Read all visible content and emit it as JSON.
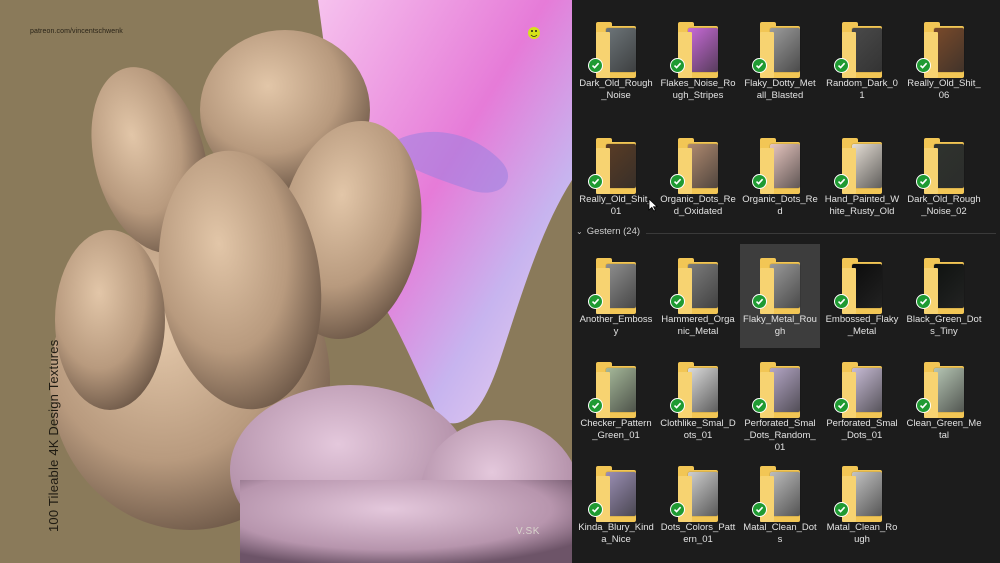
{
  "artwork": {
    "patreon_text": "patreon.com/vincentschwenk",
    "vertical_title": "100 Tileable 4K Design Textures",
    "signature": "V.SK",
    "colors": {
      "background": "#8a7a5a",
      "blob": "#b69a82",
      "rock": "#c9a9c4",
      "pink": "#f0a8e4"
    }
  },
  "explorer": {
    "group_label": "Gestern (24)",
    "check_color": "#1f9a32",
    "folder_color": "#f2c655",
    "top_grid": [
      {
        "label": "Dark_Old_Rough_Noise",
        "thumb": "#6d7579"
      },
      {
        "label": "Flakes_Noise_Rough_Stripes",
        "thumb": "#c86ad8"
      },
      {
        "label": "Flaky_Dotty_Metall_Blasted",
        "thumb": "#9c9c9c"
      },
      {
        "label": "Random_Dark_01",
        "thumb": "#4a4a4a"
      },
      {
        "label": "Really_Old_Shit_06",
        "thumb": "#7a4a2a"
      },
      {
        "label": "Really_Old_Shit_01",
        "thumb": "#5a3c25"
      },
      {
        "label": "Organic_Dots_Red_Oxidated",
        "thumb": "#b08a70"
      },
      {
        "label": "Organic_Dots_Red",
        "thumb": "#e8c6c0"
      },
      {
        "label": "Hand_Painted_White_Rusty_Old",
        "thumb": "#e6dfd6"
      },
      {
        "label": "Dark_Old_Rough_Noise_02",
        "thumb": "#2f332e"
      }
    ],
    "bottom_grid": [
      {
        "label": "Another_Embossy",
        "thumb": "#8f8f8f"
      },
      {
        "label": "Hammered_Organic_Metal",
        "thumb": "#7c7c7c"
      },
      {
        "label": "Flaky_Metal_Rough",
        "thumb": "#9a9a9a",
        "selected": true
      },
      {
        "label": "Embossed_Flaky_Metal",
        "thumb": "#0c0c0c"
      },
      {
        "label": "Black_Green_Dots_Tiny",
        "thumb": "#0f1210"
      },
      {
        "label": "Checker_Pattern_Green_01",
        "thumb": "#a6b99a"
      },
      {
        "label": "Clothlike_Smal_Dots_01",
        "thumb": "#dcdcdc"
      },
      {
        "label": "Perforated_Smal_Dots_Random_01",
        "thumb": "#b4a6c6"
      },
      {
        "label": "Perforated_Smal_Dots_01",
        "thumb": "#c8bcd6"
      },
      {
        "label": "Clean_Green_Metal",
        "thumb": "#b6c6b4"
      },
      {
        "label": "Kinda_Blury_Kinda_Nice",
        "thumb": "#9b8fb5"
      },
      {
        "label": "Dots_Colors_Pattern_01",
        "thumb": "#cfcfcf"
      },
      {
        "label": "Matal_Clean_Dots",
        "thumb": "#bdbdbd"
      },
      {
        "label": "Matal_Clean_Rough",
        "thumb": "#c4c4c4"
      }
    ]
  }
}
